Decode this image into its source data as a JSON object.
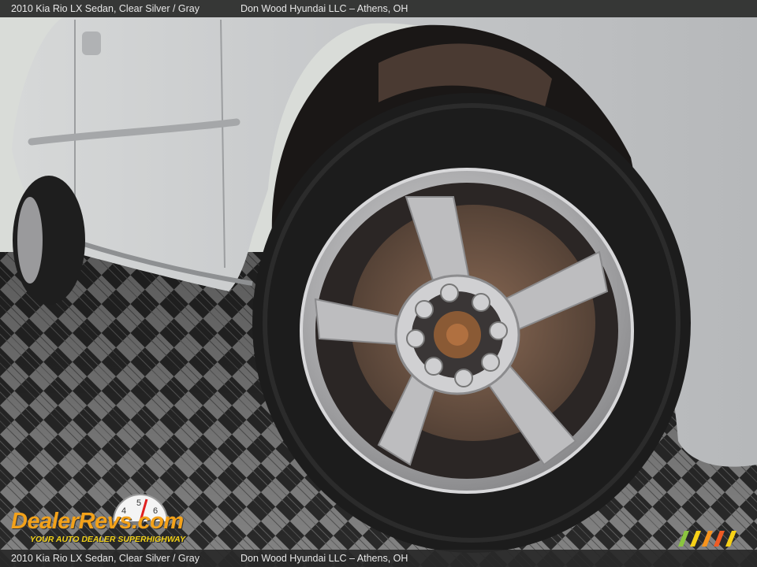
{
  "caption": {
    "vehicle": "2010 Kia Rio LX Sedan,  Clear Silver / Gray",
    "dealer": "Don Wood Hyundai LLC – Athens, OH"
  },
  "watermark": {
    "logo_text": "DealerRevs.com",
    "tagline": "YOUR AUTO DEALER SUPERHIGHWAY",
    "gauge_digits": [
      "4",
      "5",
      "6"
    ],
    "icon": "speedometer-icon"
  },
  "colors": {
    "car_body": "#c8cacc",
    "tire": "#1c1c1c",
    "rim": "#b9b9bb",
    "floor_dark": "#2c2c2c",
    "floor_light": "#8a8a8a",
    "logo_orange": "#f3a21a"
  },
  "corner_stripes": [
    "#8bc53f",
    "#f7d117",
    "#f7941d",
    "#ef5b24",
    "#f7d117"
  ]
}
